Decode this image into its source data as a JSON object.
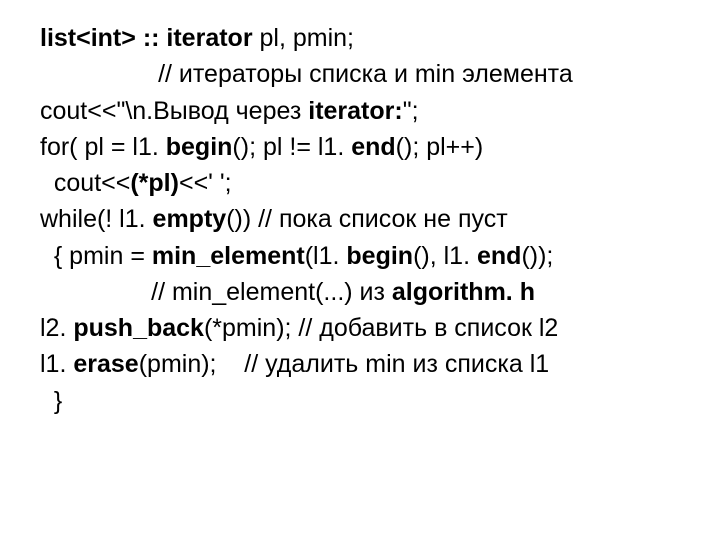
{
  "code": {
    "l1": {
      "a": "list<int> ",
      "b": ":: iterator",
      "c": " pl, pmin;"
    },
    "l2": {
      "a": "                 // итераторы списка и min элемента"
    },
    "l3": {
      "a": "cout<<\"\\n.Вывод через ",
      "b": "iterator:",
      "c": "\";"
    },
    "l4": {
      "a": "for( pl = l1. ",
      "b": "begin",
      "c": "(); pl != l1. ",
      "d": "end",
      "e": "(); pl++)"
    },
    "l5": {
      "a": "  cout<<",
      "b": "(*pl)",
      "c": "<<' ';"
    },
    "l6": {
      "a": "while(! l1. ",
      "b": "empty",
      "c": "()) // пока список не пуст"
    },
    "l7": {
      "a": "  { pmin = ",
      "b": "min_element",
      "c": "(l1. ",
      "d": "begin",
      "e": "(), l1. ",
      "f": "end",
      "g": "());"
    },
    "l8": {
      "a": "                // min_element(...) из ",
      "b": "algorithm. h"
    },
    "l9": {
      "a": "l2. ",
      "b": "push_back",
      "c": "(*pmin); // добавить в список l2"
    },
    "l10": {
      "a": "l1. ",
      "b": "erase",
      "c": "(pmin);    // удалить min из списка l1"
    },
    "l11": {
      "a": "  }"
    }
  }
}
